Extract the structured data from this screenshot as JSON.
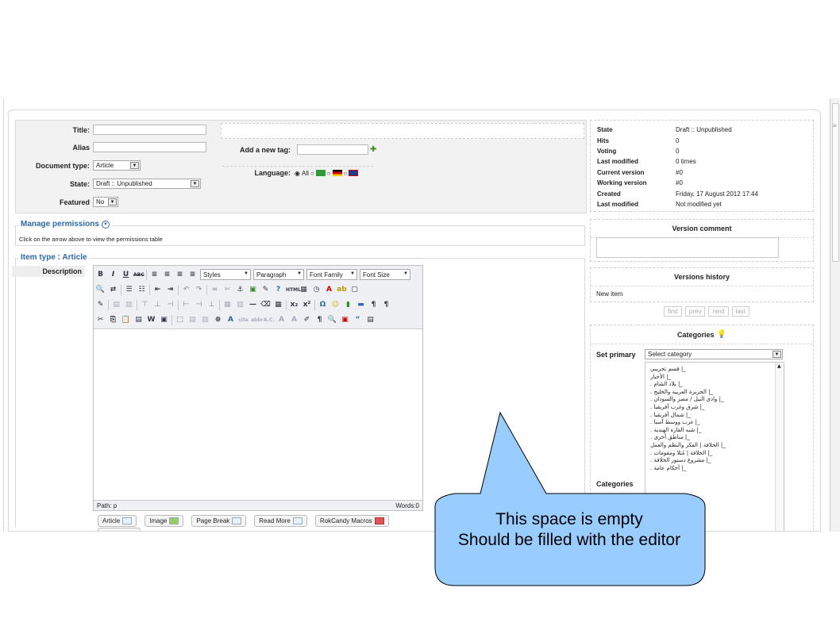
{
  "form": {
    "title_label": "Title:",
    "title_value": "",
    "alias_label": "Alias",
    "alias_value": "",
    "doctype_label": "Document type:",
    "doctype_value": "Article",
    "state_label": "State:",
    "state_value": "Draft :: Unpublished",
    "featured_label": "Featured",
    "featured_value": "No",
    "tag_label": "Add a new tag:",
    "tag_value": "",
    "language_label": "Language:",
    "language_all": "All"
  },
  "info": [
    {
      "k": "State",
      "v": "Draft :: Unpublished"
    },
    {
      "k": "Hits",
      "v": "0"
    },
    {
      "k": "Voting",
      "v": "0"
    },
    {
      "k": "Last modified",
      "v": "0 times"
    },
    {
      "k": "Current version",
      "v": "#0"
    },
    {
      "k": "Working version",
      "v": "#0"
    },
    {
      "k": "Created",
      "v": "Friday, 17 August 2012 17:44"
    },
    {
      "k": "Last modified",
      "v": "Not modified yet"
    }
  ],
  "version_comment": {
    "title": "Version comment",
    "value": ""
  },
  "versions_history": {
    "title": "Versions history",
    "item": "New item",
    "pager": [
      "first",
      "prev",
      "next",
      "last"
    ]
  },
  "categories": {
    "title": "Categories",
    "set_primary_label": "Set primary",
    "select_placeholder": "Select category",
    "list_label": "Categories",
    "items": [
      "قسم تجريبي |_",
      "الأخبار |_",
      ". بلاد الشام |_",
      ". الجزيرة العربية والخليج |_",
      ". وادي النيل / مصر والسودان |_",
      ". شرق وغرب أفريقيا |_",
      ". شمال أفريقيا |_",
      ". غرب ووسط آسيا |_",
      ". شبه القارة الهندية |_",
      ". مناطق أخرى |_",
      "الخلافة | الفكر والنظم والعمل |_",
      ". الخلافة | مُثلا ومقومات |_",
      ". مشروع دستور الخلافة |_",
      ". أحكام عامة |_"
    ]
  },
  "permissions": {
    "legend": "Manage permissions",
    "hint": "Click on the arrow above to view the permissions table"
  },
  "item_type": {
    "legend": "Item type : Article",
    "description_label": "Description"
  },
  "editor": {
    "styles": "Styles",
    "paragraph": "Paragraph",
    "font_family": "Font Family",
    "font_size": "Font Size",
    "path": "Path: p",
    "words": "Words:0",
    "buttons": [
      "Article",
      "Image",
      "Page Break",
      "Read More",
      "RokCandy Macros"
    ]
  },
  "callout": {
    "line1": "This space is empty",
    "line2": "Should be filled with the editor"
  }
}
